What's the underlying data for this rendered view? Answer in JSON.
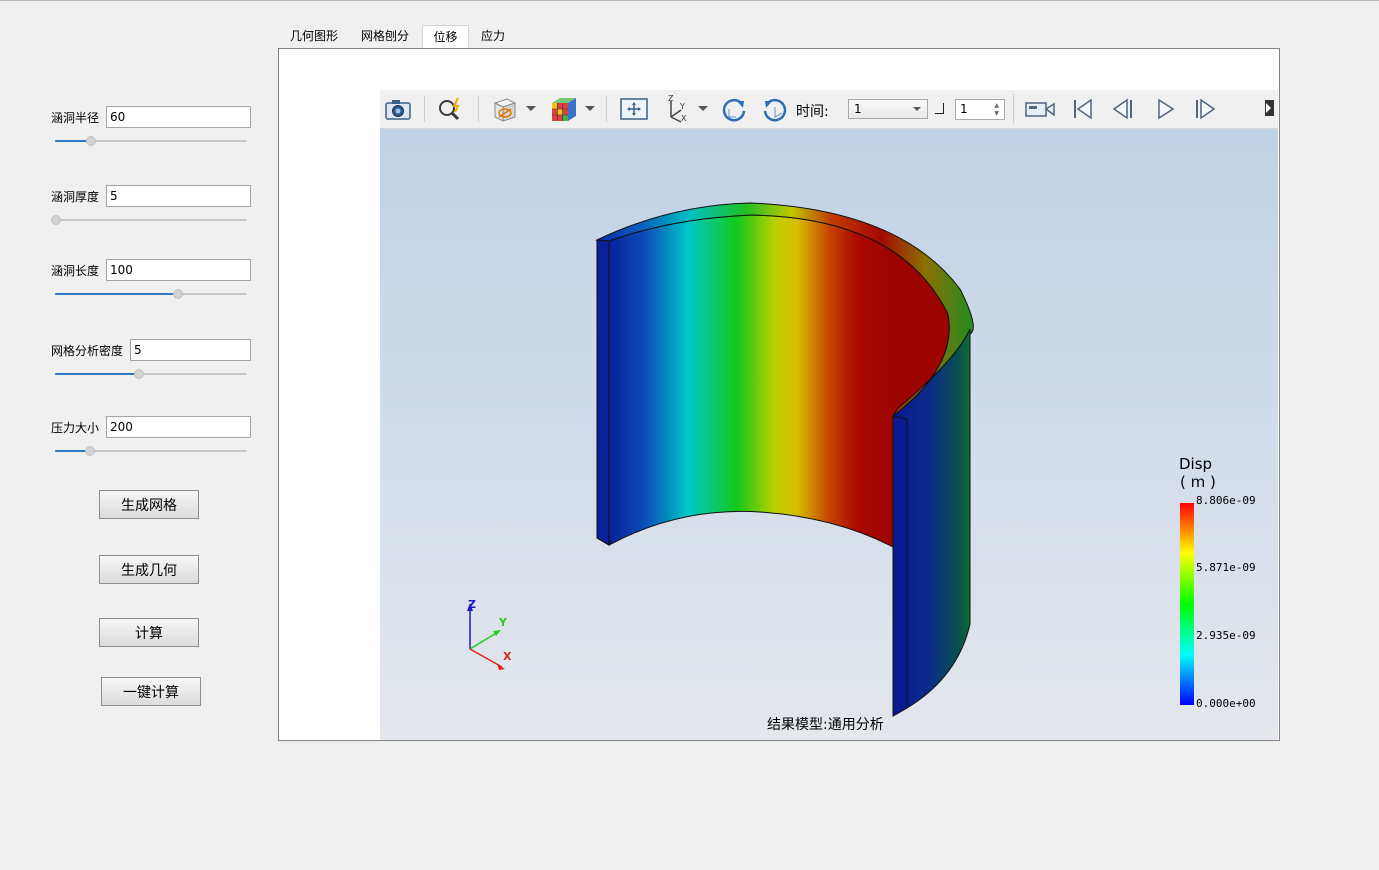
{
  "params": [
    {
      "label": "涵洞半径",
      "value": "60",
      "slider_fraction": 0.19
    },
    {
      "label": "涵洞厚度",
      "value": "5",
      "slider_fraction": 0.0
    },
    {
      "label": "涵洞长度",
      "value": "100",
      "slider_fraction": 0.64
    },
    {
      "label": "网格分析密度",
      "value": "5",
      "slider_fraction": 0.44
    },
    {
      "label": "压力大小",
      "value": "200",
      "slider_fraction": 0.18
    }
  ],
  "buttons": {
    "gen_mesh": "生成网格",
    "gen_geometry": "生成几何",
    "compute": "计算",
    "one_click": "一键计算"
  },
  "tabs": [
    {
      "label": "几何图形",
      "active": false
    },
    {
      "label": "网格刨分",
      "active": false
    },
    {
      "label": "位移",
      "active": true
    },
    {
      "label": "应力",
      "active": false
    }
  ],
  "toolbar": {
    "icons": [
      "camera-icon",
      "zoom-icon",
      "view-mode-icon",
      "color-cube-icon",
      "fit-view-icon",
      "axis-icon",
      "rotate-cw-icon",
      "rotate-ccw-icon",
      "record-icon",
      "first-frame-icon",
      "prev-frame-icon",
      "play-icon",
      "next-frame-icon",
      "more-icon"
    ],
    "time_label": "时间:",
    "time_value": "1",
    "step_value": "1"
  },
  "legend": {
    "title": "Disp",
    "unit": "( m )",
    "ticks": [
      "8.806e-09",
      "5.871e-09",
      "2.935e-09",
      "0.000e+00"
    ],
    "colors": [
      "#ff0000",
      "#ffff00",
      "#00ff00",
      "#00ffff",
      "#0000ff"
    ]
  },
  "axes": {
    "z": "Z",
    "y": "Y",
    "x": "X"
  },
  "status": "结果模型:通用分析"
}
